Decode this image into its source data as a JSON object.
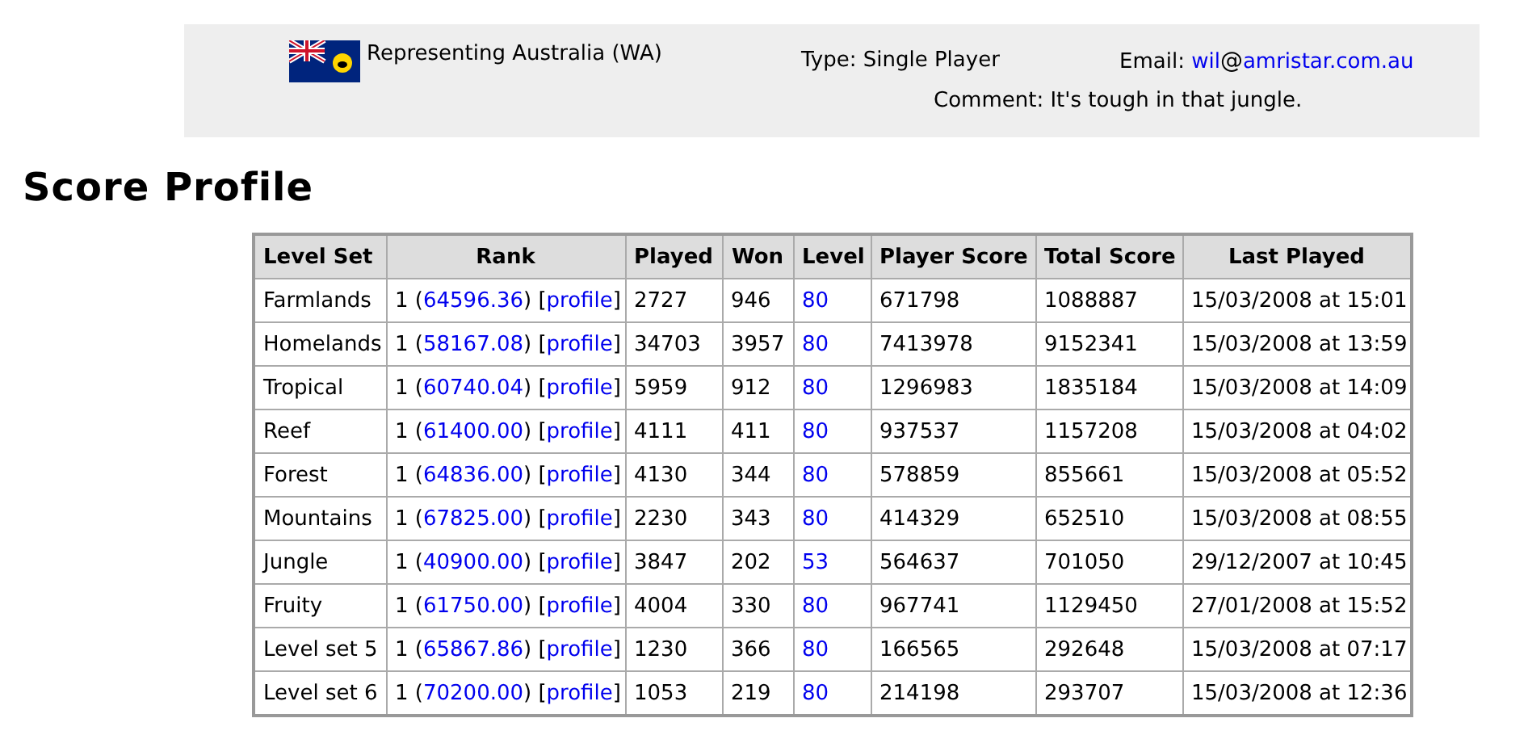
{
  "info": {
    "representing": "Representing Australia (WA)",
    "type": "Type: Single Player",
    "email": [
      {
        "kind": "text",
        "text": "Email: "
      },
      {
        "kind": "link",
        "text": "wil"
      },
      {
        "kind": "icon",
        "text": "@"
      },
      {
        "kind": "link",
        "text": "amristar.com.au"
      }
    ],
    "comment": "Comment: It's tough in that jungle."
  },
  "heading": "Score Profile",
  "table": {
    "columns": [
      "Level Set",
      "Rank",
      "Played",
      "Won",
      "Level",
      "Player Score",
      "Total Score",
      "Last Played"
    ],
    "rows": [
      {
        "level_set": "Farmlands",
        "rank": [
          {
            "kind": "text",
            "text": "1 ("
          },
          {
            "kind": "link",
            "text": "64596.36"
          },
          {
            "kind": "text",
            "text": ") ["
          },
          {
            "kind": "link",
            "text": "profile"
          },
          {
            "kind": "text",
            "text": "]"
          }
        ],
        "played": "2727",
        "won": "946",
        "level": "80",
        "player_score": "671798",
        "total_score": "1088887",
        "last_played": "15/03/2008 at 15:01"
      },
      {
        "level_set": "Homelands",
        "rank": [
          {
            "kind": "text",
            "text": "1 ("
          },
          {
            "kind": "link",
            "text": "58167.08"
          },
          {
            "kind": "text",
            "text": ") ["
          },
          {
            "kind": "link",
            "text": "profile"
          },
          {
            "kind": "text",
            "text": "]"
          }
        ],
        "played": "34703",
        "won": "3957",
        "level": "80",
        "player_score": "7413978",
        "total_score": "9152341",
        "last_played": "15/03/2008 at 13:59"
      },
      {
        "level_set": "Tropical",
        "rank": [
          {
            "kind": "text",
            "text": "1 ("
          },
          {
            "kind": "link",
            "text": "60740.04"
          },
          {
            "kind": "text",
            "text": ") ["
          },
          {
            "kind": "link",
            "text": "profile"
          },
          {
            "kind": "text",
            "text": "]"
          }
        ],
        "played": "5959",
        "won": "912",
        "level": "80",
        "player_score": "1296983",
        "total_score": "1835184",
        "last_played": "15/03/2008 at 14:09"
      },
      {
        "level_set": "Reef",
        "rank": [
          {
            "kind": "text",
            "text": "1 ("
          },
          {
            "kind": "link",
            "text": "61400.00"
          },
          {
            "kind": "text",
            "text": ") ["
          },
          {
            "kind": "link",
            "text": "profile"
          },
          {
            "kind": "text",
            "text": "]"
          }
        ],
        "played": "4111",
        "won": "411",
        "level": "80",
        "player_score": "937537",
        "total_score": "1157208",
        "last_played": "15/03/2008 at 04:02"
      },
      {
        "level_set": "Forest",
        "rank": [
          {
            "kind": "text",
            "text": "1 ("
          },
          {
            "kind": "link",
            "text": "64836.00"
          },
          {
            "kind": "text",
            "text": ") ["
          },
          {
            "kind": "link",
            "text": "profile"
          },
          {
            "kind": "text",
            "text": "]"
          }
        ],
        "played": "4130",
        "won": "344",
        "level": "80",
        "player_score": "578859",
        "total_score": "855661",
        "last_played": "15/03/2008 at 05:52"
      },
      {
        "level_set": "Mountains",
        "rank": [
          {
            "kind": "text",
            "text": "1 ("
          },
          {
            "kind": "link",
            "text": "67825.00"
          },
          {
            "kind": "text",
            "text": ") ["
          },
          {
            "kind": "link",
            "text": "profile"
          },
          {
            "kind": "text",
            "text": "]"
          }
        ],
        "played": "2230",
        "won": "343",
        "level": "80",
        "player_score": "414329",
        "total_score": "652510",
        "last_played": "15/03/2008 at 08:55"
      },
      {
        "level_set": "Jungle",
        "rank": [
          {
            "kind": "text",
            "text": "1 ("
          },
          {
            "kind": "link",
            "text": "40900.00"
          },
          {
            "kind": "text",
            "text": ") ["
          },
          {
            "kind": "link",
            "text": "profile"
          },
          {
            "kind": "text",
            "text": "]"
          }
        ],
        "played": "3847",
        "won": "202",
        "level": "53",
        "player_score": "564637",
        "total_score": "701050",
        "last_played": "29/12/2007 at 10:45"
      },
      {
        "level_set": "Fruity",
        "rank": [
          {
            "kind": "text",
            "text": "1 ("
          },
          {
            "kind": "link",
            "text": "61750.00"
          },
          {
            "kind": "text",
            "text": ") ["
          },
          {
            "kind": "link",
            "text": "profile"
          },
          {
            "kind": "text",
            "text": "]"
          }
        ],
        "played": "4004",
        "won": "330",
        "level": "80",
        "player_score": "967741",
        "total_score": "1129450",
        "last_played": "27/01/2008 at 15:52"
      },
      {
        "level_set": "Level set 5",
        "rank": [
          {
            "kind": "text",
            "text": "1 ("
          },
          {
            "kind": "link",
            "text": "65867.86"
          },
          {
            "kind": "text",
            "text": ") ["
          },
          {
            "kind": "link",
            "text": "profile"
          },
          {
            "kind": "text",
            "text": "]"
          }
        ],
        "played": "1230",
        "won": "366",
        "level": "80",
        "player_score": "166565",
        "total_score": "292648",
        "last_played": "15/03/2008 at 07:17"
      },
      {
        "level_set": "Level set 6",
        "rank": [
          {
            "kind": "text",
            "text": "1 ("
          },
          {
            "kind": "link",
            "text": "70200.00"
          },
          {
            "kind": "text",
            "text": ") ["
          },
          {
            "kind": "link",
            "text": "profile"
          },
          {
            "kind": "text",
            "text": "]"
          }
        ],
        "played": "1053",
        "won": "219",
        "level": "80",
        "player_score": "214198",
        "total_score": "293707",
        "last_played": "15/03/2008 at 12:36"
      }
    ]
  }
}
